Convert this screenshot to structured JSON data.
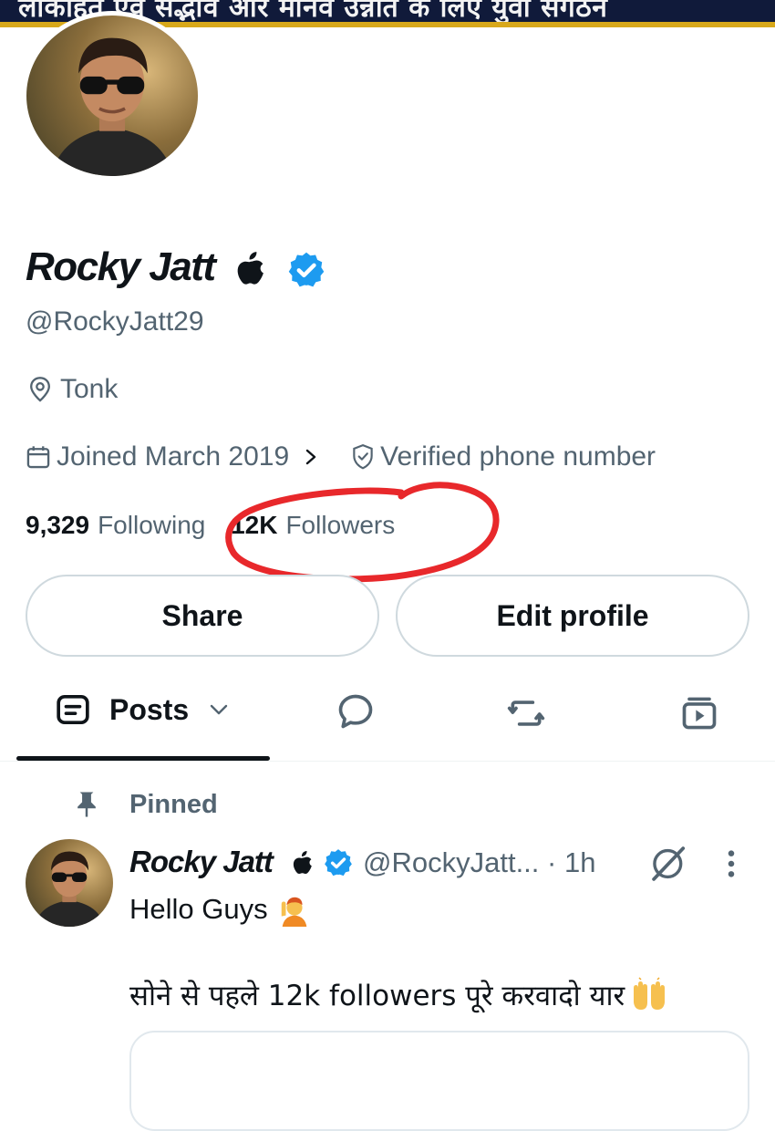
{
  "banner": {
    "text": "लोकहित एवं सद्भाव और मानव उन्नति के लिए युवा संगठन"
  },
  "profile": {
    "display_name": "Rocky Jatt",
    "handle": "@RockyJatt29",
    "location": "Tonk",
    "joined": "Joined March 2019",
    "verified_phone": "Verified phone number",
    "following_count": "9,329",
    "following_label": "Following",
    "followers_count": "12K",
    "followers_label": "Followers",
    "verified_color": "#1d9bf0"
  },
  "buttons": {
    "share": "Share",
    "edit_profile": "Edit profile"
  },
  "tabs": {
    "posts": "Posts",
    "icons": [
      "posts-icon",
      "replies-icon",
      "reposts-icon",
      "media-icon"
    ]
  },
  "pinned_post": {
    "pinned_label": "Pinned",
    "author_name": "Rocky Jatt",
    "author_handle": "@RockyJatt...",
    "time": "· 1h",
    "text_line1": "Hello Guys",
    "text_line2": "सोने से पहले 12k followers पूरे करवादो यार"
  },
  "colors": {
    "annotation_circle": "#e8282b",
    "secondary_text": "#536471"
  }
}
